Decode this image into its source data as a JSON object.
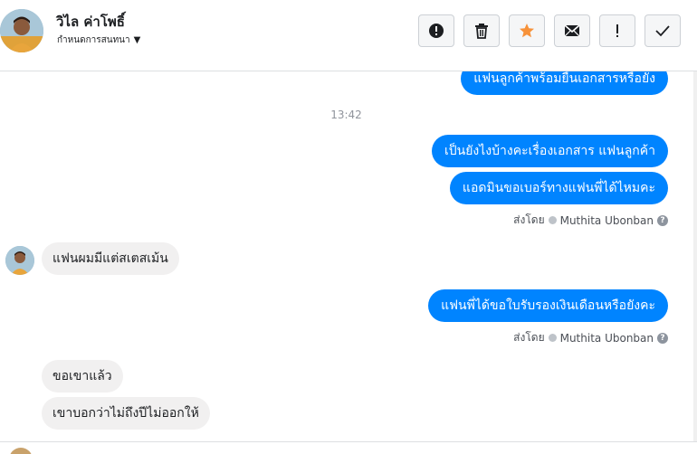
{
  "header": {
    "contact_name": "วิไล ค่าโพธิ์",
    "conversation_settings": "กำหนดการสนทนา",
    "toolbar": [
      {
        "name": "report-button",
        "icon": "alert-circle-icon"
      },
      {
        "name": "delete-button",
        "icon": "trash-icon"
      },
      {
        "name": "star-button",
        "icon": "star-icon",
        "color": "#f7923a"
      },
      {
        "name": "mail-button",
        "icon": "envelope-icon"
      },
      {
        "name": "important-button",
        "icon": "exclamation-icon"
      },
      {
        "name": "done-button",
        "icon": "check-icon"
      }
    ]
  },
  "thread": {
    "partial_top_message": "แฟนลูกค้าพร้อมยื่นเอกสารหรือยัง",
    "timestamp": "13:42",
    "outgoing_1": "เป็นยังไงบ้างคะเรื่องเอกสาร แฟนลูกค้า",
    "outgoing_2": "แอดมินขอเบอร์ทางแฟนพี่ได้ไหมคะ",
    "sent_by_label": "ส่งโดย",
    "sent_by_name": "Muthita Ubonban",
    "incoming_1": "แฟนผมมีแต่สเตสเม้น",
    "outgoing_3": "แฟนพี่ได้ขอใบรับรองเงินเดือนหรือยังคะ",
    "sent_by_label_2": "ส่งโดย",
    "sent_by_name_2": "Muthita Ubonban",
    "incoming_2": "ขอเขาแล้ว",
    "incoming_3": "เขาบอกว่าไม่ถึงปีไม่ออกให้"
  },
  "colors": {
    "outgoing_bubble": "#0084ff",
    "incoming_bubble": "#f1f0f0",
    "star": "#f7923a"
  }
}
